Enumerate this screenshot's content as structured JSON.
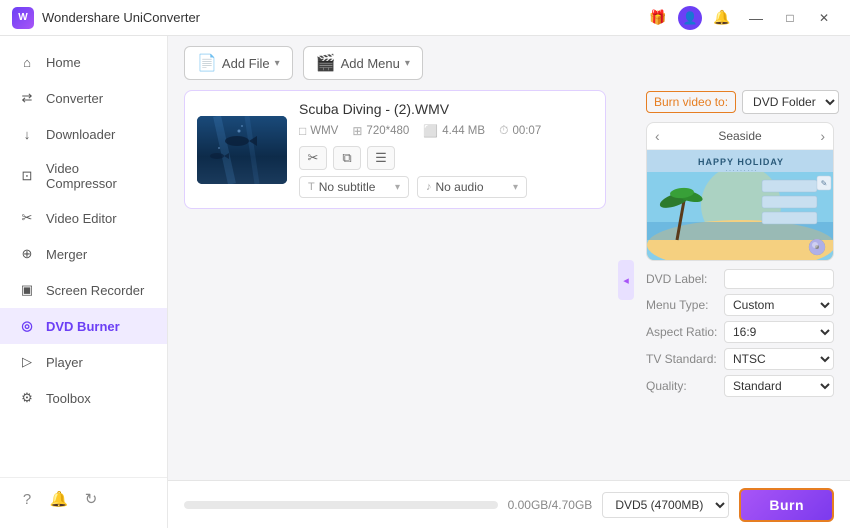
{
  "app": {
    "title": "Wondershare UniConverter",
    "logo_text": "W"
  },
  "titlebar": {
    "icons": {
      "gift": "🎁",
      "user": "👤",
      "bell": "🔔",
      "minimize": "—",
      "maximize": "□",
      "close": "✕"
    }
  },
  "sidebar": {
    "items": [
      {
        "id": "home",
        "label": "Home",
        "icon": "⌂"
      },
      {
        "id": "converter",
        "label": "Converter",
        "icon": "⇄"
      },
      {
        "id": "downloader",
        "label": "Downloader",
        "icon": "↓"
      },
      {
        "id": "video-compressor",
        "label": "Video Compressor",
        "icon": "⊡"
      },
      {
        "id": "video-editor",
        "label": "Video Editor",
        "icon": "✂"
      },
      {
        "id": "merger",
        "label": "Merger",
        "icon": "⊕"
      },
      {
        "id": "screen-recorder",
        "label": "Screen Recorder",
        "icon": "▣"
      },
      {
        "id": "dvd-burner",
        "label": "DVD Burner",
        "icon": "◎",
        "active": true
      },
      {
        "id": "player",
        "label": "Player",
        "icon": "▷"
      },
      {
        "id": "toolbox",
        "label": "Toolbox",
        "icon": "⚙"
      }
    ],
    "bottom_icons": [
      "?",
      "🔔",
      "↻"
    ]
  },
  "toolbar": {
    "add_file_label": "Add File",
    "add_menu_label": "Add Menu"
  },
  "file": {
    "name": "Scuba Diving - (2).WMV",
    "format": "WMV",
    "resolution": "720*480",
    "size": "4.44 MB",
    "duration": "00:07",
    "subtitle_label": "No subtitle",
    "audio_label": "No audio"
  },
  "right_panel": {
    "burn_to_label": "Burn video to:",
    "burn_to_value": "DVD Folder",
    "preview_title": "Seaside",
    "dvd_label_label": "DVD Label:",
    "dvd_label_value": "",
    "menu_type_label": "Menu Type:",
    "menu_type_value": "Custom",
    "aspect_ratio_label": "Aspect Ratio:",
    "aspect_ratio_value": "16:9",
    "tv_standard_label": "TV Standard:",
    "tv_standard_value": "NTSC",
    "quality_label": "Quality:",
    "quality_value": "Standard"
  },
  "bottom_bar": {
    "storage_text": "0.00GB/4.70GB",
    "dvd_option": "DVD5 (4700MB)",
    "burn_label": "Burn"
  },
  "colors": {
    "accent": "#6c3ff5",
    "accent_light": "#a855f7",
    "orange": "#e67e22",
    "sidebar_active_bg": "#f0ebff",
    "active_border": "#d0b0ff"
  }
}
